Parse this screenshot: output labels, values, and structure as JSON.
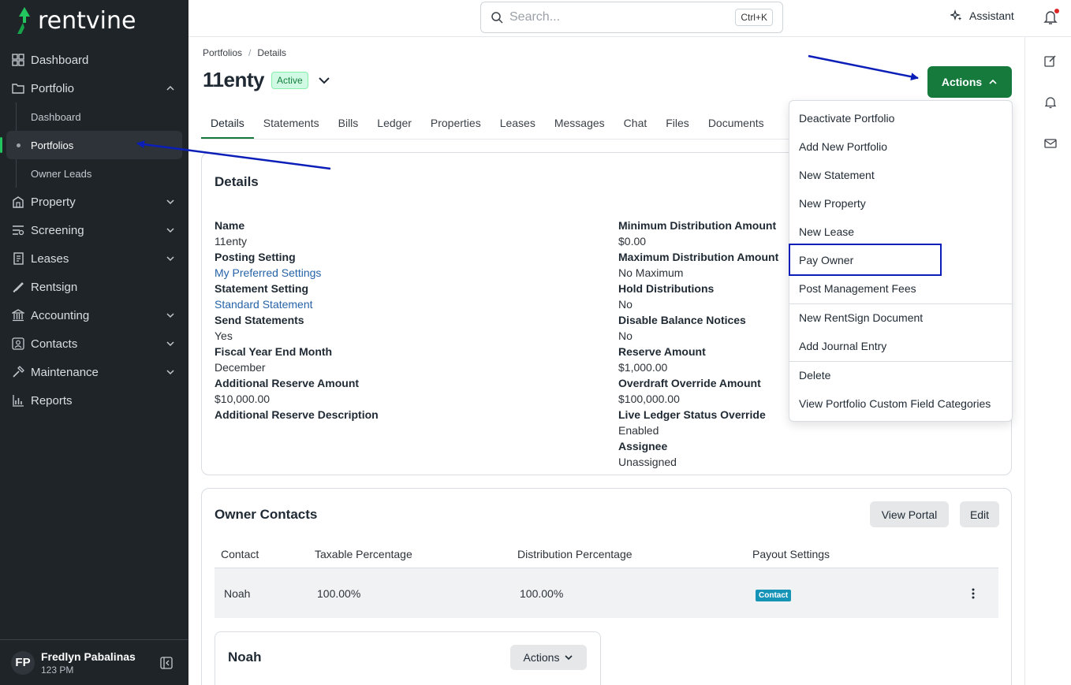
{
  "brand": {
    "name": "rentvine",
    "accent": "#157a3c",
    "sidebar_bg": "#1f2429"
  },
  "sidebar": {
    "items": [
      {
        "label": "Dashboard",
        "icon": "dashboard-icon"
      },
      {
        "label": "Portfolio",
        "icon": "portfolio-icon",
        "expanded": true,
        "children": [
          {
            "label": "Dashboard"
          },
          {
            "label": "Portfolios",
            "active": true
          },
          {
            "label": "Owner Leads"
          }
        ]
      },
      {
        "label": "Property",
        "icon": "property-icon"
      },
      {
        "label": "Screening",
        "icon": "screening-icon"
      },
      {
        "label": "Leases",
        "icon": "leases-icon"
      },
      {
        "label": "Rentsign",
        "icon": "rentsign-icon"
      },
      {
        "label": "Accounting",
        "icon": "accounting-icon"
      },
      {
        "label": "Contacts",
        "icon": "contacts-icon"
      },
      {
        "label": "Maintenance",
        "icon": "maintenance-icon"
      },
      {
        "label": "Reports",
        "icon": "reports-icon"
      }
    ],
    "user": {
      "initials": "FP",
      "name": "Fredlyn Pabalinas",
      "sub": "123 PM"
    }
  },
  "topbar": {
    "search_placeholder": "Search...",
    "search_shortcut": "Ctrl+K",
    "assistant_label": "Assistant"
  },
  "breadcrumb": [
    "Portfolios",
    "Details"
  ],
  "page": {
    "title": "11enty",
    "status": "Active"
  },
  "tabs": [
    "Details",
    "Statements",
    "Bills",
    "Ledger",
    "Properties",
    "Leases",
    "Messages",
    "Chat",
    "Files",
    "Documents"
  ],
  "actions_label": "Actions",
  "actions_menu": {
    "groups": [
      [
        "Deactivate Portfolio",
        "Add New Portfolio",
        "New Statement",
        "New Property",
        "New Lease",
        "Pay Owner",
        "Post Management Fees"
      ],
      [
        "New RentSign Document",
        "Add Journal Entry"
      ],
      [
        "Delete",
        "View Portfolio Custom Field Categories"
      ]
    ],
    "highlighted": "Pay Owner"
  },
  "details": {
    "title": "Details",
    "left": [
      {
        "label": "Name",
        "value": "11enty"
      },
      {
        "label": "Posting Setting",
        "value": "My Preferred Settings",
        "link": true
      },
      {
        "label": "Statement Setting",
        "value": "Standard Statement",
        "link": true
      },
      {
        "label": "Send Statements",
        "value": "Yes"
      },
      {
        "label": "Fiscal Year End Month",
        "value": "December"
      },
      {
        "label": "Additional Reserve Amount",
        "value": "$10,000.00"
      },
      {
        "label": "Additional Reserve Description",
        "value": ""
      }
    ],
    "right": [
      {
        "label": "Minimum Distribution Amount",
        "value": "$0.00"
      },
      {
        "label": "Maximum Distribution Amount",
        "value": "No Maximum"
      },
      {
        "label": "Hold Distributions",
        "value": "No"
      },
      {
        "label": "Disable Balance Notices",
        "value": "No"
      },
      {
        "label": "Reserve Amount",
        "value": "$1,000.00"
      },
      {
        "label": "Overdraft Override Amount",
        "value": "$100,000.00"
      },
      {
        "label": "Live Ledger Status Override",
        "value": "Enabled"
      },
      {
        "label": "Assignee",
        "value": "Unassigned"
      }
    ]
  },
  "owner_contacts": {
    "title": "Owner Contacts",
    "view_portal_label": "View Portal",
    "edit_label": "Edit",
    "columns": [
      "Contact",
      "Taxable Percentage",
      "Distribution Percentage",
      "Payout Settings"
    ],
    "rows": [
      {
        "contact": "Noah",
        "taxable": "100.00%",
        "distribution": "100.00%",
        "payout": "Contact"
      }
    ],
    "sub_card": {
      "title": "Noah",
      "actions_label": "Actions"
    }
  }
}
